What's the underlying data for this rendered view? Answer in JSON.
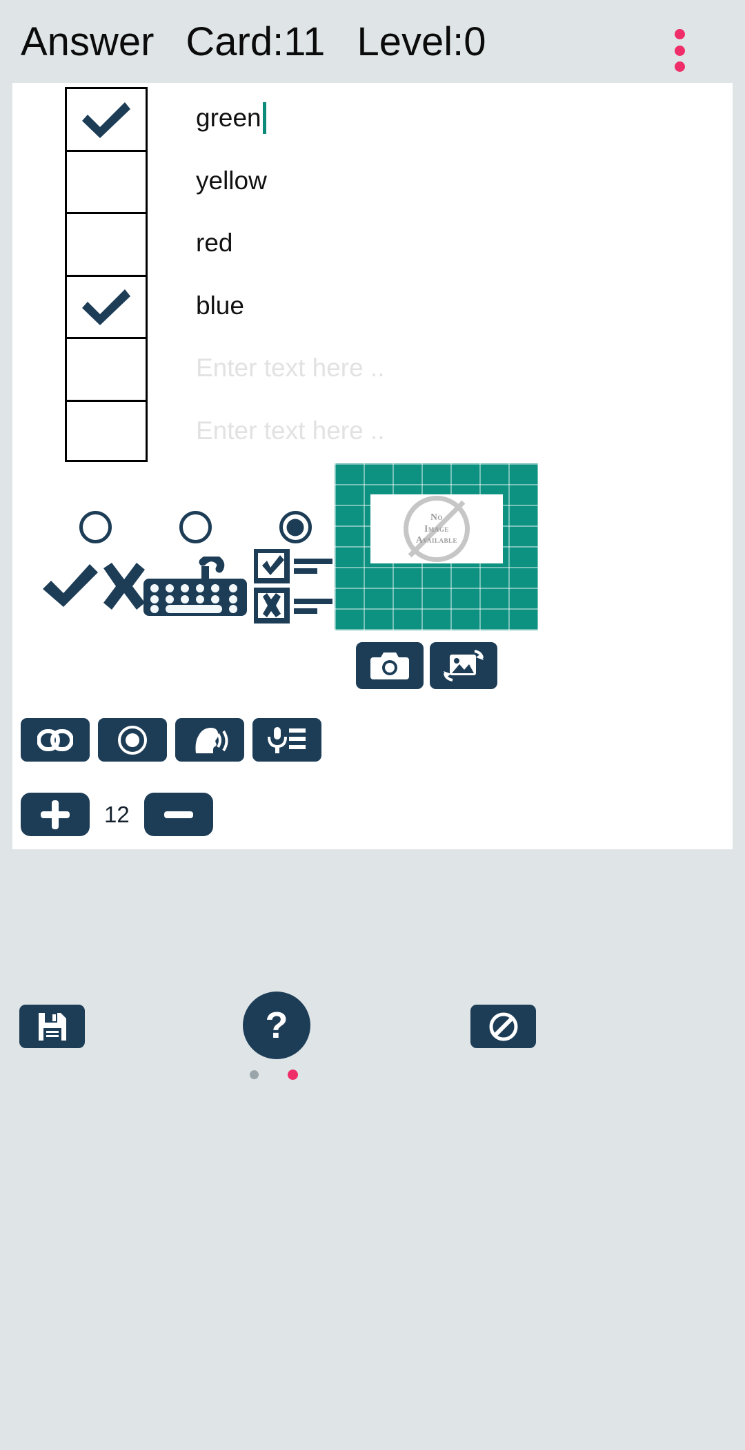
{
  "header": {
    "title": "Answer",
    "card_label": "Card:11",
    "level_label": "Level:0",
    "menu_icon": "kebab-menu-icon",
    "accent_color": "#ef2d68"
  },
  "answer_list": {
    "placeholder": "Enter text here ..",
    "rows": [
      {
        "text": "green",
        "checked": true,
        "is_placeholder": false,
        "has_caret": true
      },
      {
        "text": "yellow",
        "checked": false,
        "is_placeholder": false,
        "has_caret": false
      },
      {
        "text": "red",
        "checked": false,
        "is_placeholder": false,
        "has_caret": false
      },
      {
        "text": "blue",
        "checked": true,
        "is_placeholder": false,
        "has_caret": false
      },
      {
        "text": "Enter text here ..",
        "checked": false,
        "is_placeholder": true,
        "has_caret": false
      },
      {
        "text": "Enter text here ..",
        "checked": false,
        "is_placeholder": true,
        "has_caret": false
      }
    ]
  },
  "answer_types": [
    {
      "name": "true-false",
      "icon": "check-cross-icon",
      "selected": false
    },
    {
      "name": "text-entry",
      "icon": "keyboard-icon",
      "selected": false
    },
    {
      "name": "multiple-choice",
      "icon": "multiple-choice-icon",
      "selected": true
    }
  ],
  "image_panel": {
    "no_image_lines": [
      "No",
      "Image",
      "Available"
    ],
    "background_color": "#0d9181",
    "icon": "no-image-icon"
  },
  "media_buttons": [
    {
      "name": "camera-button",
      "icon": "camera-icon"
    },
    {
      "name": "gallery-button",
      "icon": "image-swap-icon"
    }
  ],
  "tool_buttons": [
    {
      "name": "link-button",
      "icon": "link-icon"
    },
    {
      "name": "record-button",
      "icon": "record-icon"
    },
    {
      "name": "text-to-speech-button",
      "icon": "speaking-head-icon"
    },
    {
      "name": "speech-to-text-button",
      "icon": "microphone-list-icon"
    }
  ],
  "counter": {
    "increment_icon": "plus-icon",
    "decrement_icon": "minus-icon",
    "value": "12"
  },
  "bottom_bar": {
    "save_icon": "floppy-disk-icon",
    "help_label": "?",
    "cancel_icon": "no-entry-icon"
  },
  "colors": {
    "primary": "#1d3d57",
    "page_bg": "#dfe5e7",
    "card_bg": "#ffffff",
    "caret": "#0c8b7b"
  }
}
